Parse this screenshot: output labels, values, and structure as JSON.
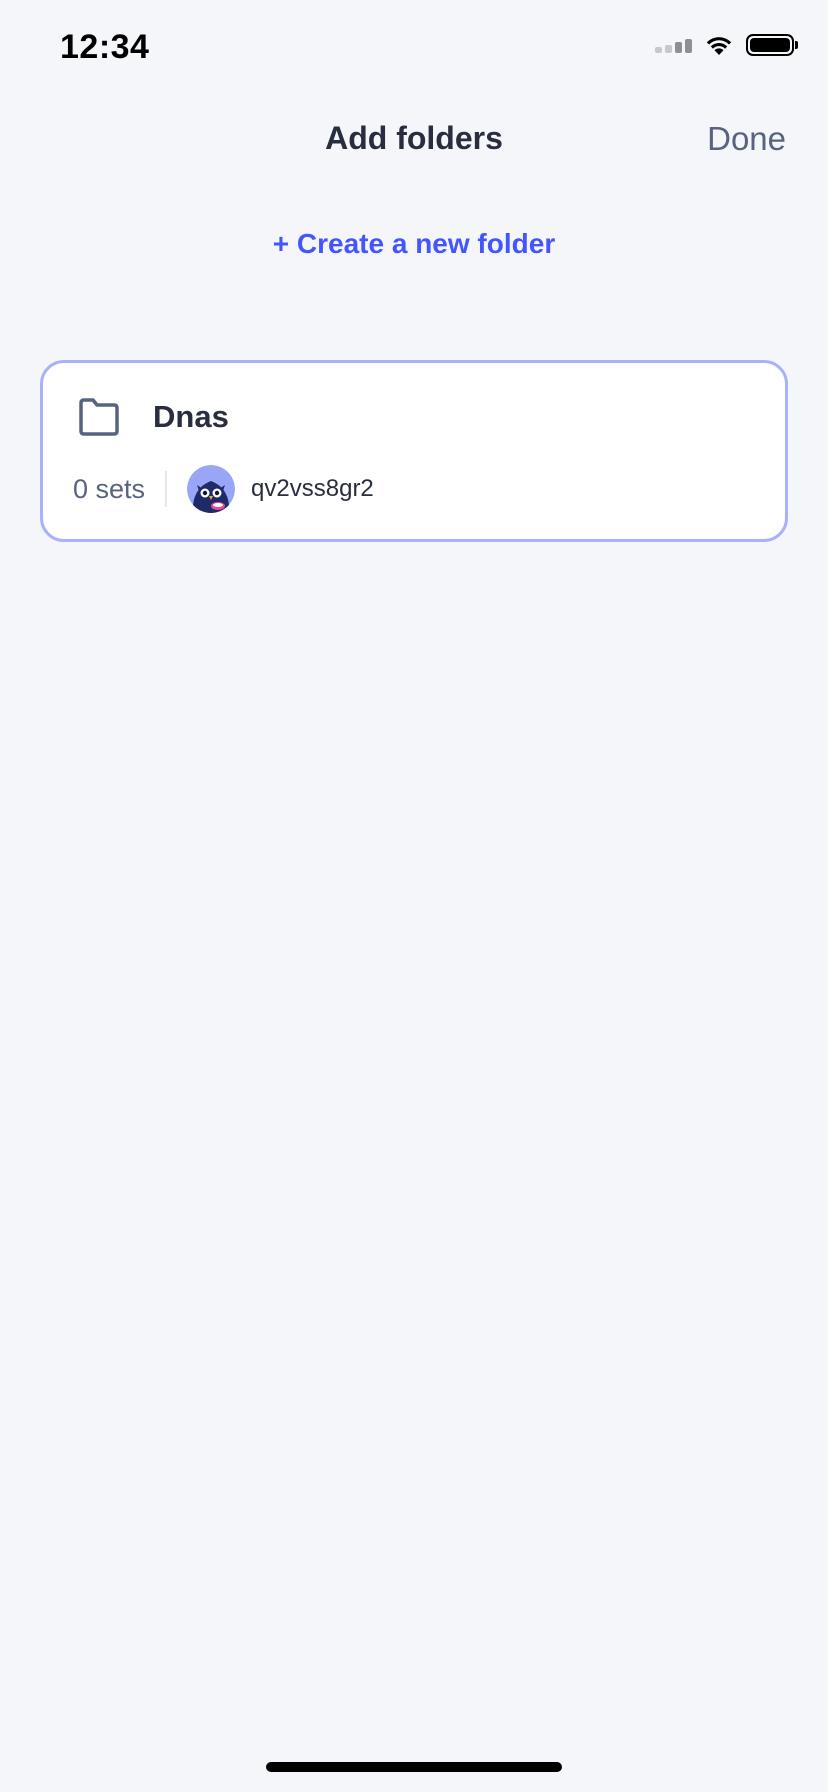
{
  "status_bar": {
    "time": "12:34"
  },
  "nav": {
    "title": "Add folders",
    "done_label": "Done"
  },
  "actions": {
    "create_folder_label": "+ Create a new folder"
  },
  "folders": [
    {
      "name": "Dnas",
      "count_label": "0 sets",
      "username": "qv2vss8gr2",
      "selected": true
    }
  ],
  "colors": {
    "accent": "#4255ff",
    "selected_border": "#a8b1ff",
    "background": "#f5f6fa",
    "text_primary": "#282e3e",
    "text_secondary": "#586380"
  },
  "icons": {
    "folder": "folder-icon",
    "avatar": "owl-avatar"
  }
}
